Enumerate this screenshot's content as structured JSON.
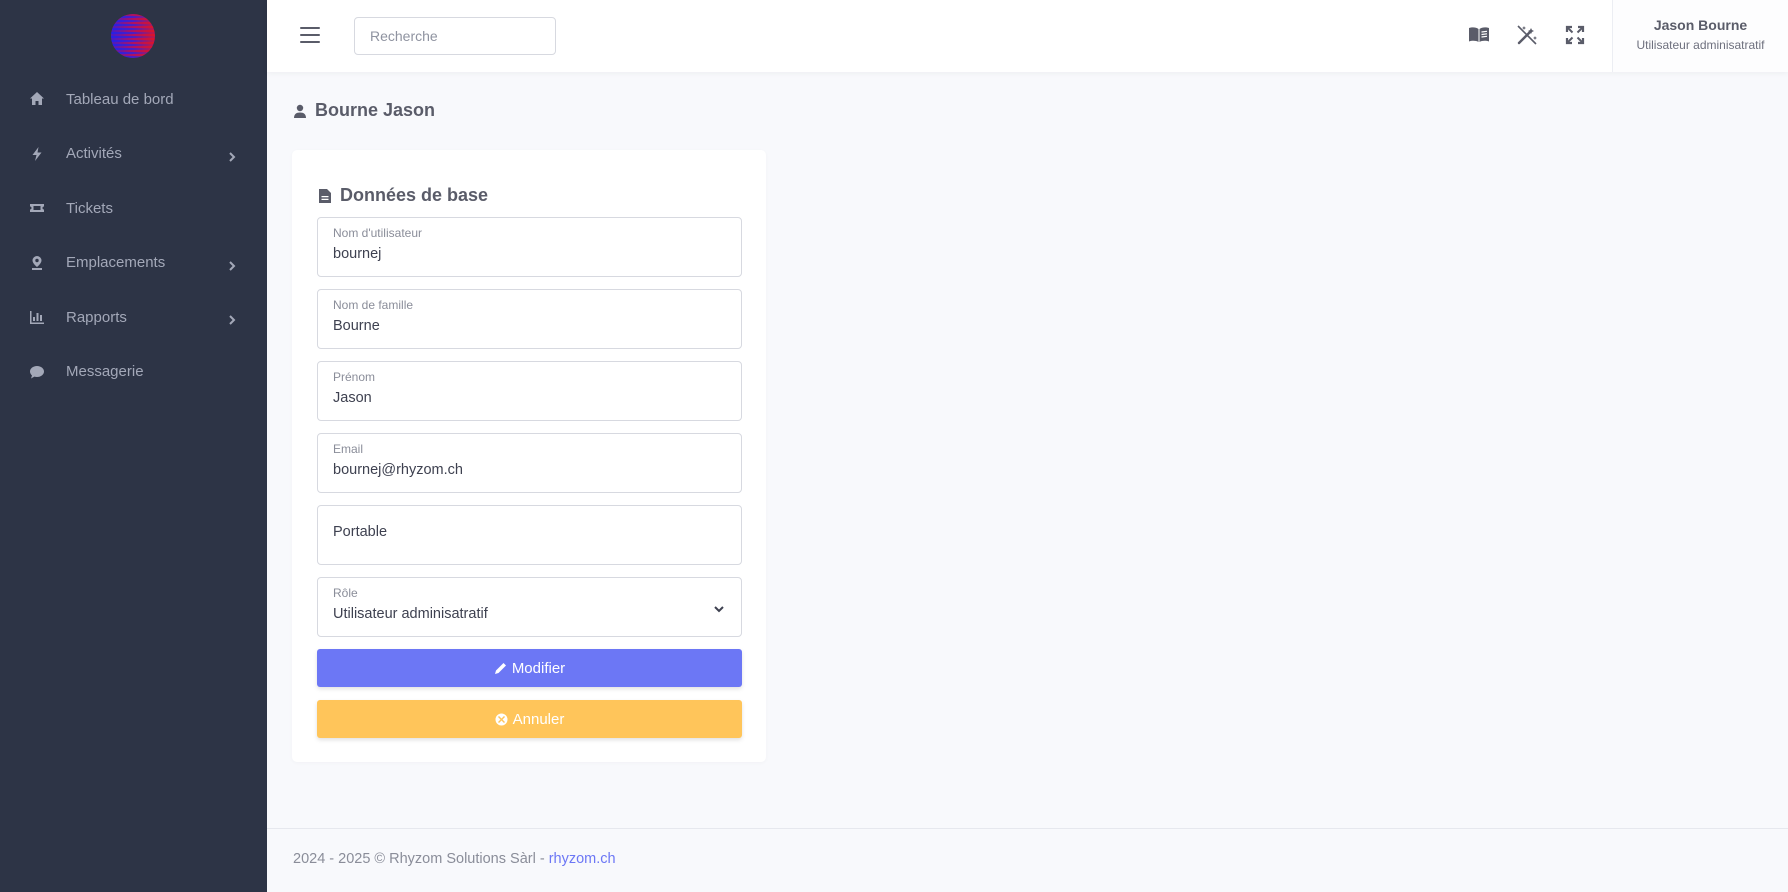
{
  "sidebar": {
    "items": [
      {
        "label": "Tableau de bord",
        "icon": "home-icon",
        "has_children": false
      },
      {
        "label": "Activités",
        "icon": "bolt-icon",
        "has_children": true
      },
      {
        "label": "Tickets",
        "icon": "ticket-icon",
        "has_children": false
      },
      {
        "label": "Emplacements",
        "icon": "map-pin-icon",
        "has_children": true
      },
      {
        "label": "Rapports",
        "icon": "bar-chart-icon",
        "has_children": true
      },
      {
        "label": "Messagerie",
        "icon": "chat-icon",
        "has_children": false
      }
    ]
  },
  "topbar": {
    "search_placeholder": "Recherche",
    "icons": [
      "book-icon",
      "magic-wand-icon",
      "fullscreen-icon"
    ],
    "user_name": "Jason Bourne",
    "user_role": "Utilisateur adminisatratif"
  },
  "page": {
    "title": "Bourne Jason"
  },
  "form": {
    "title": "Données de base",
    "fields": [
      {
        "label": "Nom d'utilisateur",
        "value": "bournej"
      },
      {
        "label": "Nom de famille",
        "value": "Bourne"
      },
      {
        "label": "Prénom",
        "value": "Jason"
      },
      {
        "label": "Email",
        "value": "bournej@rhyzom.ch"
      },
      {
        "label": "",
        "value": "Portable"
      },
      {
        "label": "Rôle",
        "value": "Utilisateur adminisatratif"
      }
    ],
    "modify_label": "Modifier",
    "cancel_label": "Annuler"
  },
  "footer": {
    "text": "2024 - 2025 © Rhyzom Solutions Sàrl - ",
    "link": "rhyzom.ch"
  },
  "colors": {
    "sidebar_bg": "#2d3446",
    "primary": "#6c77f5",
    "warning": "#ffc55a",
    "page_bg": "#f8f9fc"
  }
}
